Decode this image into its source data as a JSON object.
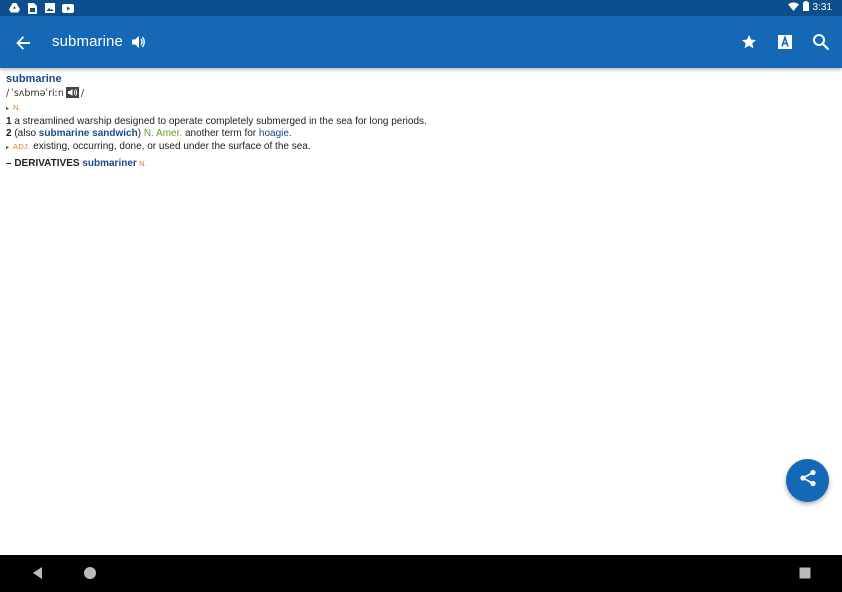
{
  "status_bar": {
    "left_icons": [
      "drive-icon",
      "sim-icon",
      "image-icon",
      "youtube-icon"
    ],
    "time": "3:31"
  },
  "app_bar": {
    "title": "submarine",
    "actions": [
      "star-icon",
      "font-size-icon",
      "search-icon"
    ]
  },
  "entry": {
    "headword": "submarine",
    "pronunciation_open": "/",
    "pronunciation": "ˈsʌbməˈriːn",
    "pronunciation_close": "/",
    "pos_noun": "N.",
    "sense1_num": "1",
    "sense1_text": "a streamlined warship designed to operate completely submerged in the sea for long periods.",
    "sense2_num": "2",
    "sense2_pre": " (also ",
    "sense2_xref": "submarine sandwich",
    "sense2_mid": ") ",
    "sense2_region": "N. Amer.",
    "sense2_text": " another term for ",
    "sense2_link": "hoagie",
    "sense2_end": ".",
    "pos_adj": "ADJ.",
    "adj_text": " existing, occurring, done, or used under the surface of the sea.",
    "derivatives_label": "– DERIVATIVES ",
    "derivative_word": "submariner",
    "derivative_pos": " N."
  },
  "colors": {
    "app_bar": "#1468b6",
    "status_bar": "#0d4f8c",
    "headword": "#1a4a8e",
    "pos": "#e07b24",
    "region": "#5aa02c"
  }
}
